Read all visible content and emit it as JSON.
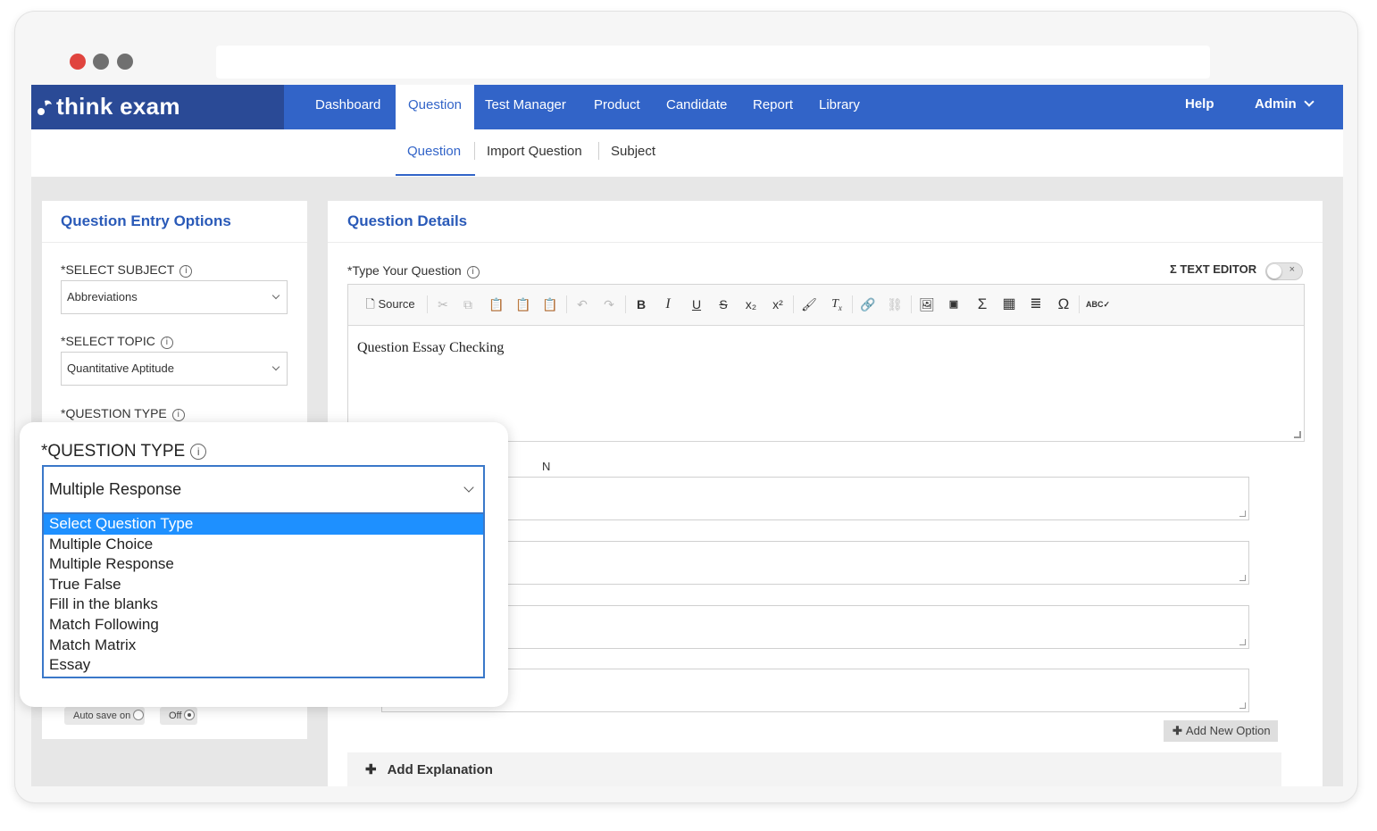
{
  "app": {
    "logo_text": "think exam",
    "nav": [
      "Dashboard",
      "Question",
      "Test Manager",
      "Product",
      "Candidate",
      "Report",
      "Library"
    ],
    "nav_active": "Question",
    "help": "Help",
    "admin": "Admin"
  },
  "subnav": {
    "items": [
      "Question",
      "Import Question",
      "Subject"
    ],
    "active": "Question"
  },
  "left_panel": {
    "title": "Question Entry Options",
    "subject_label": "*SELECT SUBJECT",
    "subject_value": "Abbreviations",
    "topic_label": "*SELECT TOPIC",
    "topic_value": "Quantitative Aptitude",
    "qtype_label": "*QUESTION TYPE",
    "autosave_label": "Auto save on",
    "off_label": "Off"
  },
  "right_panel": {
    "title": "Question Details",
    "question_label": "*Type Your Question",
    "text_editor_label": "Σ TEXT EDITOR",
    "toggle_x": "×",
    "toolbar": {
      "source": "Source"
    },
    "editor_content": "Question Essay Checking",
    "options_label_fragment": "N",
    "add_option": "Add New Option",
    "add_explanation": "Add Explanation"
  },
  "popup": {
    "label": "*QUESTION TYPE",
    "selected_value": "Multiple Response",
    "options": [
      "Select Question Type",
      "Multiple Choice",
      "Multiple Response",
      "True False",
      "Fill in the blanks",
      "Match Following",
      "Match Matrix",
      "Essay"
    ],
    "highlighted_index": 0
  },
  "colors": {
    "brand": "#3264c8",
    "brand_dark": "#2a4a96",
    "highlight": "#1e90ff"
  }
}
